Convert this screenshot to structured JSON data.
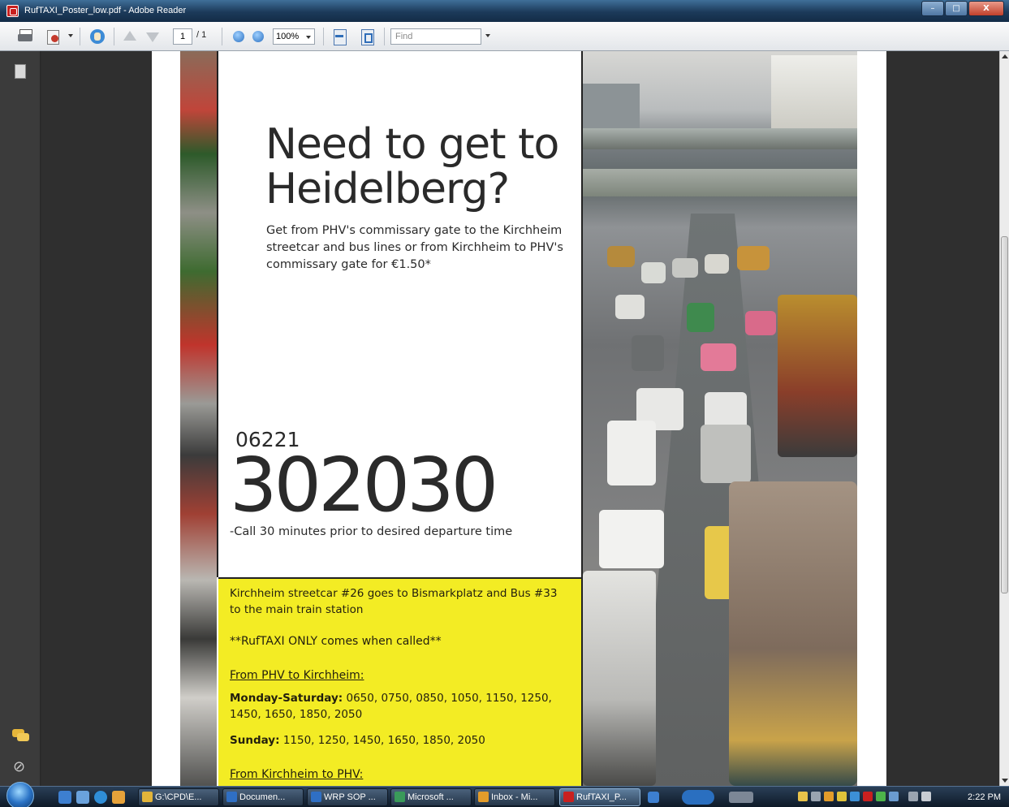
{
  "window": {
    "title": "RufTAXI_Poster_low.pdf - Adobe Reader",
    "minimize_glyph": "–",
    "maximize_glyph": "□",
    "close_glyph": "X"
  },
  "toolbar": {
    "page_current": "1",
    "page_total": "/ 1",
    "zoom": "100%",
    "find_placeholder": "Find"
  },
  "sidebar": {
    "attach_glyph": "⊘"
  },
  "poster": {
    "headline": "Need to get to\nHeidelberg?",
    "subtext": "Get from PHV's commissary gate to the Kirchheim streetcar and bus lines or from Kirchheim to PHV's commissary gate for €1.50*",
    "phone_prefix": "06221",
    "phone_number": "302030",
    "phone_note": "-Call 30 minutes prior to desired departure time",
    "info": {
      "routes": "Kirchheim streetcar #26 goes to Bismarkplatz and Bus #33 to the main train station",
      "only_called": "**RufTAXI ONLY comes when called**",
      "from_phv_heading": "From PHV to Kirchheim:",
      "weekday_label": "Monday-Saturday:",
      "weekday_times": "0650, 0750, 0850, 1050, 1150, 1250, 1450, 1650, 1850, 2050",
      "sunday_label": "Sunday:",
      "sunday_times": "1150, 1250, 1450, 1650, 1850, 2050",
      "from_kirchheim_heading": "From Kirchheim to PHV:"
    }
  },
  "taskbar": {
    "tasks": [
      {
        "label": "G:\\CPD\\E...",
        "color": "#e2b43a"
      },
      {
        "label": "Documen...",
        "color": "#2f6fc4"
      },
      {
        "label": "WRP SOP ...",
        "color": "#2f6fc4"
      },
      {
        "label": "Microsoft ...",
        "color": "#3a9a5a"
      },
      {
        "label": "Inbox - Mi...",
        "color": "#e39c2a"
      },
      {
        "label": "RufTAXI_P...",
        "color": "#c9201f"
      }
    ],
    "clock": "2:22 PM"
  },
  "colors": {
    "poster_yellow": "#f3ec24",
    "titlebar_blue": "#1c3a5a"
  }
}
